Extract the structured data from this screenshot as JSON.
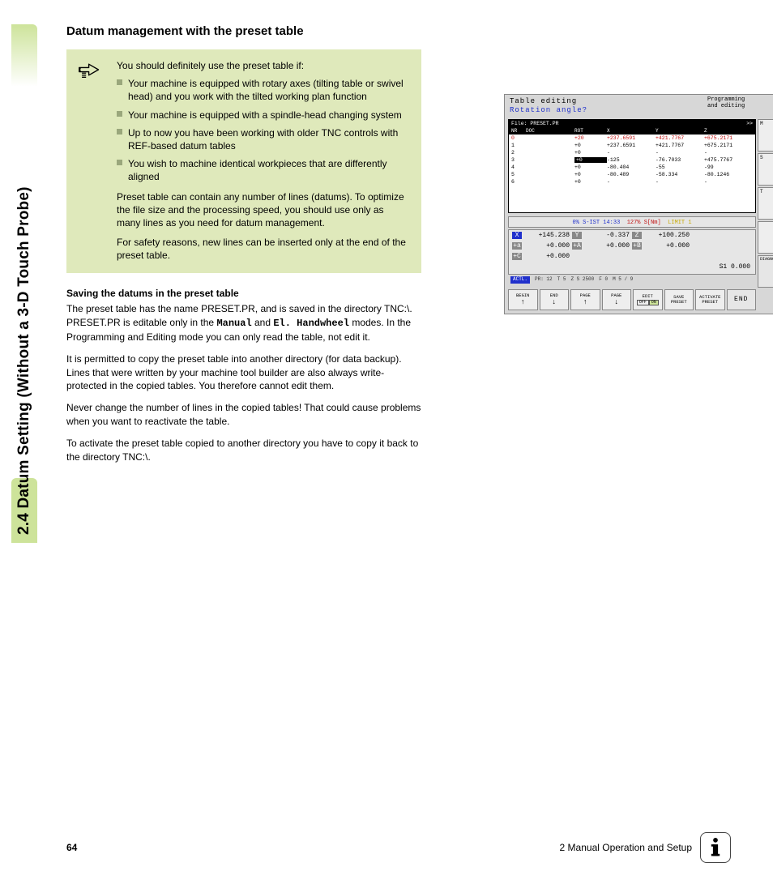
{
  "side_tab": "2.4 Datum Setting (Without a 3-D Touch Probe)",
  "section_title": "Datum management with the preset table",
  "note": {
    "intro": "You should definitely use the preset table if:",
    "bullets": [
      "Your machine is equipped with rotary axes (tilting table or swivel head) and you work with the tilted working plan function",
      "Your machine is equipped with a spindle-head changing system",
      "Up to now you have been working with older TNC controls with REF-based datum tables",
      "You wish to machine identical workpieces that are differently aligned"
    ],
    "p1": "Preset table can contain any number of lines (datums). To optimize the file size and the processing speed, you should use only as many lines as you need for datum management.",
    "p2": "For safety reasons, new lines can be inserted only at the end of the preset table."
  },
  "sub_heading": "Saving the datums in the preset table",
  "body": {
    "p1a": "The preset table has the name PRESET.PR, and is saved in the directory TNC:\\. PRESET.PR is editable only in the ",
    "mono1": "Manual",
    "p1b": " and ",
    "mono2": "El. Handwheel",
    "p1c": " modes. In the Programming and Editing mode you can only read the table, not edit it.",
    "p2": "It is permitted to copy the preset table into another directory (for data backup). Lines that were written by your machine tool builder are also always write-protected in the copied tables. You therefore cannot edit them.",
    "p3": "Never change the number of lines in the copied tables! That could cause problems when you want to reactivate the table.",
    "p4": "To activate the preset table copied to another directory you have to copy it back to the directory TNC:\\."
  },
  "screen": {
    "title": "Table editing",
    "subtitle": "Rotation angle?",
    "mode": "Programming and editing",
    "file": "File: PRESET.PR",
    "arrow": ">>",
    "cols": [
      "NR",
      "DOC",
      "ROT",
      "X",
      "Y",
      "Z"
    ],
    "rows": [
      {
        "nr": "0",
        "doc": "",
        "rot": "+20",
        "x": "+237.6591",
        "y": "+421.7767",
        "z": "+675.2171",
        "cls": "red"
      },
      {
        "nr": "1",
        "doc": "",
        "rot": "+0",
        "x": "+237.6591",
        "y": "+421.7767",
        "z": "+675.2171"
      },
      {
        "nr": "2",
        "doc": "",
        "rot": "+0",
        "x": "-",
        "y": "-",
        "z": "-"
      },
      {
        "nr": "3",
        "doc": "",
        "rot": "+0",
        "x": "-125",
        "y": "-76.7033",
        "z": "+475.7767",
        "hl": true
      },
      {
        "nr": "4",
        "doc": "",
        "rot": "+0",
        "x": "-80.404",
        "y": "-55",
        "z": "-99"
      },
      {
        "nr": "5",
        "doc": "",
        "rot": "+0",
        "x": "-80.489",
        "y": "-58.334",
        "z": "-80.1246"
      },
      {
        "nr": "6",
        "doc": "",
        "rot": "+0",
        "x": "-",
        "y": "-",
        "z": "-"
      }
    ],
    "status": {
      "pct": "0% S-IST 14:33",
      "snm": "127% S[Nm]",
      "lim": "LIMIT 1"
    },
    "coords": {
      "l1": [
        {
          "ax": "X",
          "v": "+145.238"
        },
        {
          "ax": "Y",
          "v": "-0.337"
        },
        {
          "ax": "Z",
          "v": "+100.250"
        }
      ],
      "l2": [
        {
          "ax": "+a",
          "v": "+0.000"
        },
        {
          "ax": "+A",
          "v": "+0.000"
        },
        {
          "ax": "+B",
          "v": "+0.000"
        }
      ],
      "l3": [
        {
          "ax": "+C",
          "v": "+0.000"
        }
      ],
      "s1": "S1   0.000"
    },
    "info": {
      "actl": "ACTL.",
      "pr": "PR: 12",
      "t": "T 5",
      "zs": "Z S 2500",
      "f": "F 0",
      "ms": "M 5 / 9"
    },
    "softkeys": [
      {
        "l1": "BEGIN",
        "arr": "↑"
      },
      {
        "l1": "END",
        "arr": "↓"
      },
      {
        "l1": "PAGE",
        "arr": "↑"
      },
      {
        "l1": "PAGE",
        "arr": "↓"
      },
      {
        "l1": "EDIT",
        "toggle": true,
        "off": "OFF",
        "on": "ON"
      },
      {
        "l1": "SAVE",
        "l2": "PRESET"
      },
      {
        "l1": "ACTIVATE",
        "l2": "PRESET"
      },
      {
        "l1": "END",
        "end": true
      }
    ],
    "side_labels": {
      "m": "M",
      "s": "S",
      "t": "T",
      "diag": "DIAGNOSIS"
    }
  },
  "footer": {
    "page": "64",
    "chapter": "2 Manual Operation and Setup"
  }
}
